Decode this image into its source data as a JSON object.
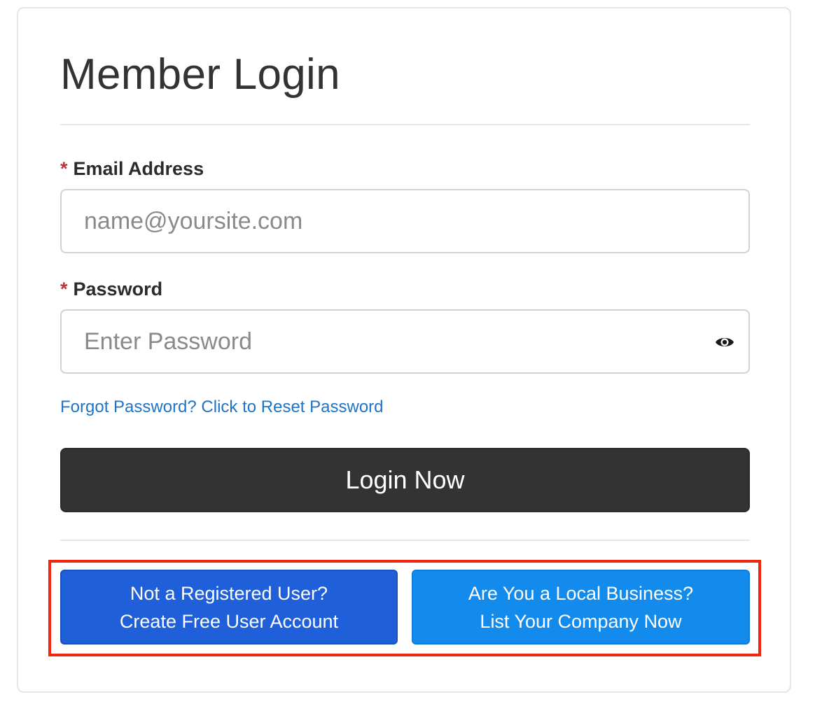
{
  "login": {
    "title": "Member Login",
    "required_marker": "*",
    "email": {
      "label": "Email Address",
      "placeholder": "name@yoursite.com",
      "value": ""
    },
    "password": {
      "label": "Password",
      "placeholder": "Enter Password",
      "value": "",
      "toggle_icon": "eye-icon"
    },
    "forgot_link": "Forgot Password? Click to Reset Password",
    "submit_label": "Login Now"
  },
  "signup": {
    "user_button": {
      "line1": "Not a Registered User?",
      "line2": "Create Free User Account",
      "color": "#1f5fd9"
    },
    "business_button": {
      "line1": "Are You a Local Business?",
      "line2": "List Your Company Now",
      "color": "#138bec"
    },
    "highlight_color": "#f0260e"
  },
  "colors": {
    "required": "#b33a3a",
    "link": "#1f74c6",
    "primary_button": "#333333"
  }
}
